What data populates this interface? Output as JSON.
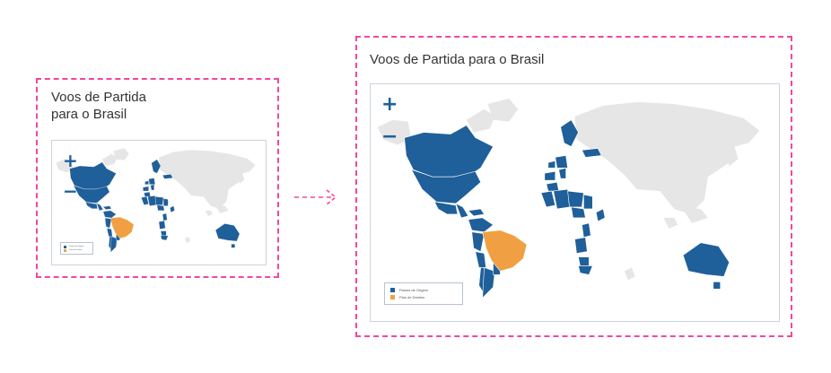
{
  "cards": {
    "small": {
      "title": "Voos de Partida\npara o Brasil"
    },
    "large": {
      "title": "Voos de Partida para o Brasil"
    }
  },
  "map": {
    "zoom_in_label": "+",
    "zoom_out_label": "−",
    "legend": [
      {
        "label": "Países de Origem",
        "color": "#1f5f9a"
      },
      {
        "label": "País de Destino",
        "color": "#f0a042"
      }
    ]
  },
  "colors": {
    "origin": "#1f5f9a",
    "destination": "#f0a042",
    "land": "#e6e6e6",
    "frame": "#f0489e"
  },
  "icons": {
    "zoom_in": "plus-icon",
    "zoom_out": "minus-icon",
    "transition": "dashed-arrow-right-icon"
  }
}
